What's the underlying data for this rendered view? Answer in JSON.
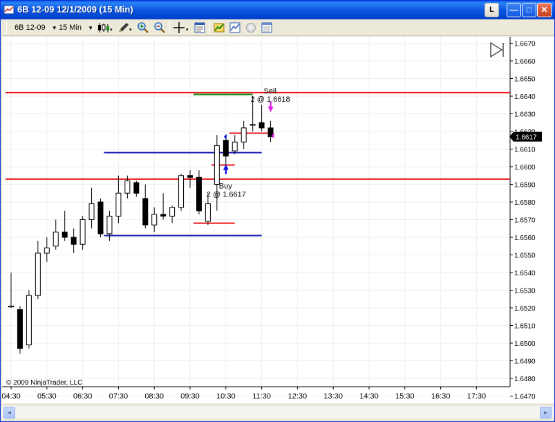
{
  "window": {
    "title": "6B 12-09  12/1/2009 (15 Min)",
    "layout_button": "L",
    "minimize_glyph": "—",
    "maximize_glyph": "□",
    "close_glyph": "✕"
  },
  "toolbar": {
    "instrument": "6B 12-09",
    "interval": "15 Min",
    "icons": [
      "candlestick-style-icon",
      "drawing-pencil-icon",
      "zoom-in-icon",
      "zoom-out-icon",
      "crosshair-icon",
      "data-box-icon",
      "strategies-icon",
      "indicators-icon",
      "chart-trader-icon",
      "properties-icon"
    ]
  },
  "colors": {
    "red_line": "#e8161a",
    "blue_line": "#1a1ab4",
    "green_line": "#0c8a0c",
    "buy_arrow": "#1010e0",
    "sell_arrow": "#e020e0",
    "bear_candle": "#000000",
    "bull_candle": "#ffffff"
  },
  "chart_data": {
    "type": "candlestick",
    "copyright": "© 2009 NinjaTrader, LLC",
    "x_tick_labels": [
      "04:30",
      "05:30",
      "06:30",
      "07:30",
      "08:30",
      "09:30",
      "10:30",
      "11:30",
      "12:30",
      "13:30",
      "14:30",
      "15:30",
      "16:30",
      "17:30"
    ],
    "y_tick_labels": [
      "1.6670",
      "1.6660",
      "1.6650",
      "1.6640",
      "1.6630",
      "1.6620",
      "1.6610",
      "1.6600",
      "1.6590",
      "1.6580",
      "1.6570",
      "1.6560",
      "1.6550",
      "1.6540",
      "1.6530",
      "1.6520",
      "1.6510",
      "1.6500",
      "1.6490",
      "1.6480",
      "1.6470"
    ],
    "ylim": [
      1.6465,
      1.6675
    ],
    "last_price_label": "1.6617",
    "candles": [
      {
        "time": "04:30",
        "o": 1.6521,
        "h": 1.654,
        "l": 1.652,
        "c": 1.6521
      },
      {
        "time": "04:45",
        "o": 1.6519,
        "h": 1.6521,
        "l": 1.6494,
        "c": 1.6497
      },
      {
        "time": "05:00",
        "o": 1.6499,
        "h": 1.653,
        "l": 1.6497,
        "c": 1.6527
      },
      {
        "time": "05:15",
        "o": 1.6527,
        "h": 1.6558,
        "l": 1.6525,
        "c": 1.6551
      },
      {
        "time": "05:30",
        "o": 1.6551,
        "h": 1.656,
        "l": 1.6546,
        "c": 1.6554
      },
      {
        "time": "05:45",
        "o": 1.6555,
        "h": 1.657,
        "l": 1.6553,
        "c": 1.6563
      },
      {
        "time": "06:00",
        "o": 1.6563,
        "h": 1.6575,
        "l": 1.6558,
        "c": 1.656
      },
      {
        "time": "06:15",
        "o": 1.656,
        "h": 1.6565,
        "l": 1.6551,
        "c": 1.6556
      },
      {
        "time": "06:30",
        "o": 1.6556,
        "h": 1.6572,
        "l": 1.6553,
        "c": 1.657
      },
      {
        "time": "06:45",
        "o": 1.657,
        "h": 1.6588,
        "l": 1.6565,
        "c": 1.6579
      },
      {
        "time": "07:00",
        "o": 1.658,
        "h": 1.6582,
        "l": 1.656,
        "c": 1.6562
      },
      {
        "time": "07:15",
        "o": 1.6562,
        "h": 1.6575,
        "l": 1.6558,
        "c": 1.6572
      },
      {
        "time": "07:30",
        "o": 1.6572,
        "h": 1.6595,
        "l": 1.6568,
        "c": 1.6585
      },
      {
        "time": "07:45",
        "o": 1.6585,
        "h": 1.6595,
        "l": 1.6582,
        "c": 1.6592
      },
      {
        "time": "08:00",
        "o": 1.6591,
        "h": 1.6592,
        "l": 1.6583,
        "c": 1.6585
      },
      {
        "time": "08:15",
        "o": 1.6582,
        "h": 1.659,
        "l": 1.6565,
        "c": 1.6567
      },
      {
        "time": "08:30",
        "o": 1.6567,
        "h": 1.6577,
        "l": 1.6563,
        "c": 1.6573
      },
      {
        "time": "08:45",
        "o": 1.6573,
        "h": 1.6585,
        "l": 1.657,
        "c": 1.6572
      },
      {
        "time": "09:00",
        "o": 1.6572,
        "h": 1.6578,
        "l": 1.6568,
        "c": 1.6577
      },
      {
        "time": "09:15",
        "o": 1.6577,
        "h": 1.6596,
        "l": 1.6575,
        "c": 1.6595
      },
      {
        "time": "09:30",
        "o": 1.6595,
        "h": 1.6598,
        "l": 1.6588,
        "c": 1.6594
      },
      {
        "time": "09:45",
        "o": 1.6594,
        "h": 1.6598,
        "l": 1.6573,
        "c": 1.6575
      },
      {
        "time": "10:00",
        "o": 1.6569,
        "h": 1.6585,
        "l": 1.6567,
        "c": 1.6579
      },
      {
        "time": "10:15",
        "o": 1.659,
        "h": 1.6618,
        "l": 1.6575,
        "c": 1.6612
      },
      {
        "time": "10:30",
        "o": 1.6615,
        "h": 1.6618,
        "l": 1.66,
        "c": 1.6606
      },
      {
        "time": "10:45",
        "o": 1.6609,
        "h": 1.6618,
        "l": 1.6607,
        "c": 1.6614
      },
      {
        "time": "11:00",
        "o": 1.6614,
        "h": 1.6626,
        "l": 1.661,
        "c": 1.6622
      },
      {
        "time": "11:15",
        "o": 1.6624,
        "h": 1.664,
        "l": 1.662,
        "c": 1.6624
      },
      {
        "time": "11:30",
        "o": 1.6625,
        "h": 1.6635,
        "l": 1.662,
        "c": 1.6622
      },
      {
        "time": "11:45",
        "o": 1.6622,
        "h": 1.6626,
        "l": 1.6614,
        "c": 1.6617
      }
    ],
    "horizontal_lines": [
      {
        "color": "red",
        "value": 1.6642,
        "x_from": "04:30",
        "x_to": "end"
      },
      {
        "color": "red",
        "value": 1.6593,
        "x_from": "04:30",
        "x_to": "end"
      },
      {
        "color": "blue",
        "value": 1.6608,
        "x_from": "07:15",
        "x_to": "11:30"
      },
      {
        "color": "blue",
        "value": 1.6561,
        "x_from": "07:15",
        "x_to": "11:30"
      },
      {
        "color": "green",
        "value": 1.6641,
        "x_from": "09:45",
        "x_to": "11:15"
      },
      {
        "color": "red",
        "value": 1.6601,
        "x_from": "10:15",
        "x_to": "10:45"
      },
      {
        "color": "red",
        "value": 1.6568,
        "x_from": "09:45",
        "x_to": "10:45"
      },
      {
        "color": "red",
        "value": 1.6619,
        "x_from": "10:45",
        "x_to": "11:45"
      }
    ],
    "markers": [
      {
        "type": "buy",
        "time": "10:30",
        "price": 1.6617,
        "label": "Buy",
        "detail": "2 @ 1.6617"
      },
      {
        "type": "sell",
        "time": "11:45",
        "price": 1.6618,
        "label": "Sell",
        "detail": "2 @ 1.6618"
      }
    ]
  },
  "scrollbar": {
    "left_glyph": "◂",
    "right_glyph": "▸"
  }
}
